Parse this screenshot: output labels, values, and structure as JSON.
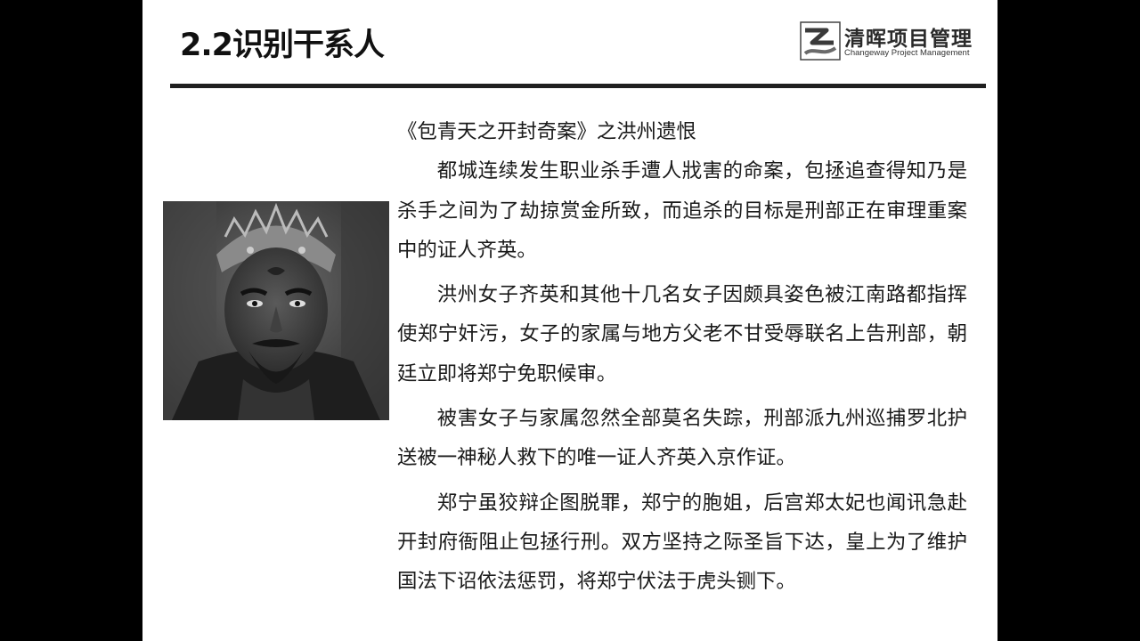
{
  "slide": {
    "title": "2.2识别干系人",
    "logo": {
      "name": "清晖项目管理",
      "subtitle": "Changeway Project Management"
    }
  },
  "story": {
    "title": "《包青天之开封奇案》之洪州遗恨",
    "paragraphs": [
      "都城连续发生职业杀手遭人戕害的命案，包拯追查得知乃是杀手之间为了劫掠赏金所致，而追杀的目标是刑部正在审理重案中的证人齐英。",
      "洪州女子齐英和其他十几名女子因颇具姿色被江南路都指挥使郑宁奸污，女子的家属与地方父老不甘受辱联名上告刑部，朝廷立即将郑宁免职候审。",
      "被害女子与家属忽然全部莫名失踪，刑部派九州巡捕罗北护送被一神秘人救下的唯一证人齐英入京作证。",
      "郑宁虽狡辩企图脱罪，郑宁的胞姐，后宫郑太妃也闻讯急赴开封府衙阻止包拯行刑。双方坚持之际圣旨下达，皇上为了维护国法下诏依法惩罚，将郑宁伏法于虎头铡下。"
    ]
  },
  "colors": {
    "background": "#000000",
    "slide": "#ffffff",
    "rule": "#1f1f1f",
    "text": "#1a1a1a"
  }
}
